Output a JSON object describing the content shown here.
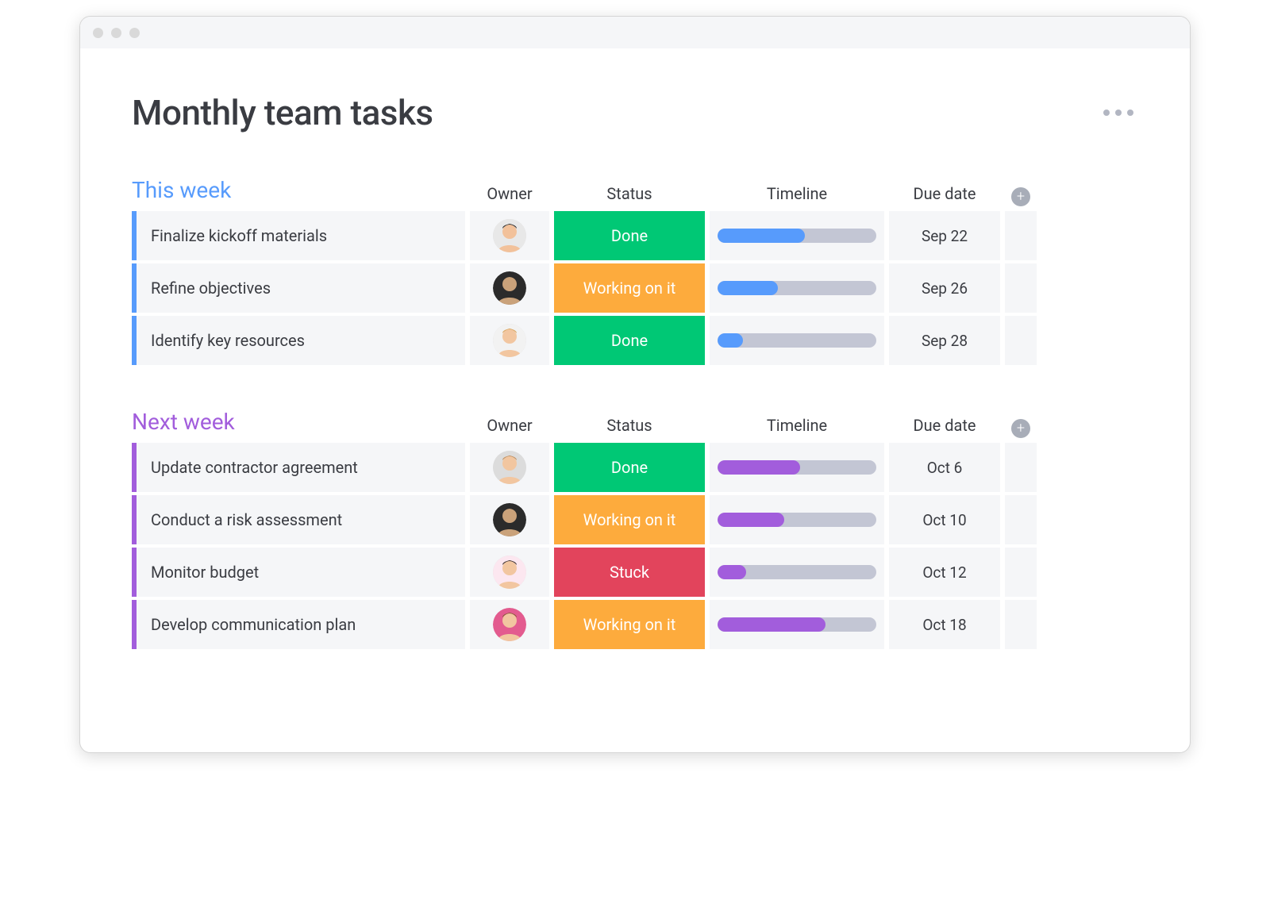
{
  "page": {
    "title": "Monthly team tasks"
  },
  "columns": {
    "owner": "Owner",
    "status": "Status",
    "timeline": "Timeline",
    "due": "Due date"
  },
  "colors": {
    "done": "#00c875",
    "working": "#fdab3d",
    "stuck": "#e2445c",
    "blue": "#579bfc",
    "purple": "#a25ddc",
    "track": "#c3c6d4"
  },
  "groups": [
    {
      "title": "This week",
      "color": "#579bfc",
      "rows": [
        {
          "task": "Finalize kickoff materials",
          "owner": "avatar1",
          "status": "Done",
          "status_color": "#00c875",
          "timeline_pct": 55,
          "due": "Sep 22"
        },
        {
          "task": "Refine objectives",
          "owner": "avatar2",
          "status": "Working on it",
          "status_color": "#fdab3d",
          "timeline_pct": 38,
          "due": "Sep 26"
        },
        {
          "task": "Identify key resources",
          "owner": "avatar3",
          "status": "Done",
          "status_color": "#00c875",
          "timeline_pct": 16,
          "due": "Sep 28"
        }
      ]
    },
    {
      "title": "Next week",
      "color": "#a25ddc",
      "rows": [
        {
          "task": "Update contractor agreement",
          "owner": "avatar4",
          "status": "Done",
          "status_color": "#00c875",
          "timeline_pct": 52,
          "due": "Oct 6"
        },
        {
          "task": "Conduct a risk assessment",
          "owner": "avatar2",
          "status": "Working on it",
          "status_color": "#fdab3d",
          "timeline_pct": 42,
          "due": "Oct 10"
        },
        {
          "task": "Monitor budget",
          "owner": "avatar5",
          "status": "Stuck",
          "status_color": "#e2445c",
          "timeline_pct": 18,
          "due": "Oct 12"
        },
        {
          "task": "Develop communication plan",
          "owner": "avatar6",
          "status": "Working on it",
          "status_color": "#fdab3d",
          "timeline_pct": 68,
          "due": "Oct 18"
        }
      ]
    }
  ]
}
